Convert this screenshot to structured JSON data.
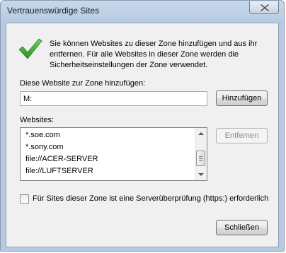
{
  "window": {
    "title": "Vertrauenswürdige Sites",
    "close_icon": "close-icon"
  },
  "intro": {
    "icon": "checkmark-icon",
    "line1": "Sie können Websites zu dieser Zone hinzufügen und aus ihr",
    "line2": "entfernen. Für alle Websites in dieser Zone werden die",
    "line3": "Sicherheitseinstellungen der Zone verwendet."
  },
  "add": {
    "label": "Diese Website zur Zone hinzufügen:",
    "value": "M:",
    "button_label": "Hinzufügen"
  },
  "sites": {
    "label": "Websites:",
    "items": [
      "*.soe.com",
      "*.sony.com",
      "file://ACER-SERVER",
      "file://LUFTSERVER"
    ],
    "remove_label": "Entfernen"
  },
  "https": {
    "checked": false,
    "label": "Für Sites dieser Zone ist eine Serverüberprüfung (https:) erforderlich"
  },
  "footer": {
    "close_label": "Schließen"
  },
  "colors": {
    "checkmark": "#3aa833",
    "frame": "#b6cbe3",
    "client": "#f0f0f0"
  }
}
